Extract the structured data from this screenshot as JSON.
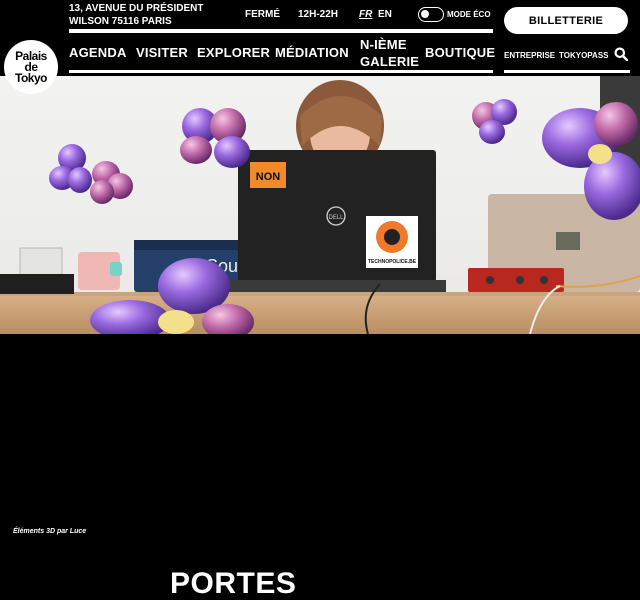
{
  "header": {
    "address": "13, AVENUE DU PRÉSIDENT WILSON 75116 PARIS",
    "status": "FERMÉ",
    "hours": "12H-22H",
    "lang_fr": "FR",
    "lang_en": "EN",
    "mode_label": "MODE ÉCO",
    "ticket_label": "BILLETTERIE",
    "logo_lines": [
      "Palais",
      "de",
      "Tokyo"
    ]
  },
  "nav": {
    "items": [
      "AGENDA",
      "VISITER",
      "EXPLORER",
      "MÉDIATION",
      "N-IÈME GALERIE",
      "BOUTIQUE"
    ],
    "sub": [
      "ENTREPRISE",
      "TOKYOPASS"
    ]
  },
  "hero": {
    "sticker_non": "NON",
    "sticker_techno": "TECHNOPOLICE.BE",
    "brand_dell": "DELL",
    "brand_soundcraft": "Soundcraft"
  },
  "credit": "Éléments 3D par Luce",
  "section_title": "PORTES",
  "colors": {
    "background": "#000000",
    "accent_purple": "#8a5fd6",
    "accent_pink": "#d98ab5"
  }
}
